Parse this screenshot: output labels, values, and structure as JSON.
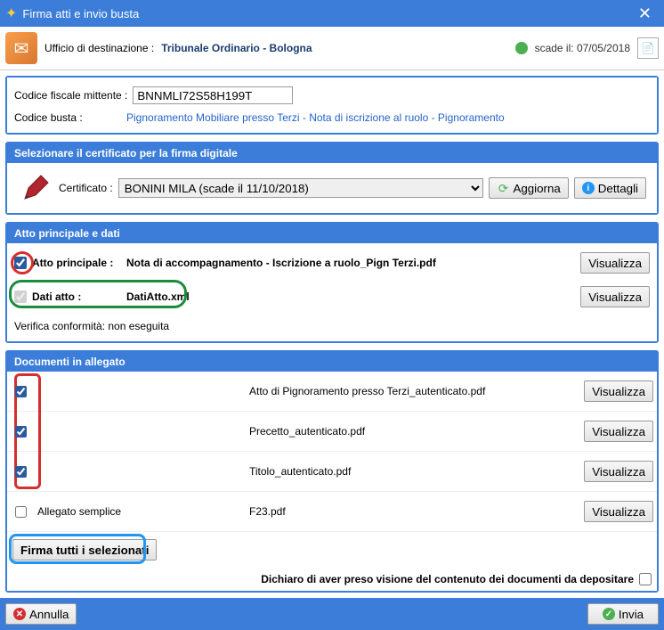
{
  "window": {
    "title": "Firma atti e invio busta"
  },
  "header": {
    "dest_label": "Ufficio di destinazione :",
    "destination": "Tribunale Ordinario - Bologna",
    "expiry_label": "scade il:",
    "expiry_date": "07/05/2018"
  },
  "fiscal": {
    "cf_label": "Codice fiscale mittente :",
    "cf_value": "BNNMLI72S58H199T",
    "busta_label": "Codice  busta :",
    "busta_value": "Pignoramento Mobiliare presso Terzi - Nota di iscrizione al ruolo - Pignoramento"
  },
  "certificate": {
    "panel_title": "Selezionare il certificato per la firma digitale",
    "label": "Certificato :",
    "selected": "BONINI MILA (scade il 11/10/2018)",
    "refresh_label": "Aggiorna",
    "details_label": "Dettagli"
  },
  "atto": {
    "panel_title": "Atto principale e dati",
    "principale_label": "Atto principale :",
    "principale_file": "Nota di accompagnamento - Iscrizione a ruolo_Pign Terzi.pdf",
    "dati_label": "Dati atto :",
    "dati_file": "DatiAtto.xml",
    "visualizza_label": "Visualizza",
    "conformita": "Verifica conformità: non eseguita"
  },
  "documents": {
    "panel_title": "Documenti in allegato",
    "visualizza_label": "Visualizza",
    "rows": [
      {
        "type": "",
        "file": "Atto di Pignoramento presso Terzi_autenticato.pdf",
        "checked": true
      },
      {
        "type": "",
        "file": "Precetto_autenticato.pdf",
        "checked": true
      },
      {
        "type": "",
        "file": "Titolo_autenticato.pdf",
        "checked": true
      },
      {
        "type": "Allegato semplice",
        "file": "F23.pdf",
        "checked": false
      }
    ],
    "sign_all_label": "Firma tutti i selezionati",
    "declaration": "Dichiaro di aver preso visione del contenuto dei documenti da depositare"
  },
  "footer": {
    "cancel_label": "Annulla",
    "send_label": "Invia"
  }
}
